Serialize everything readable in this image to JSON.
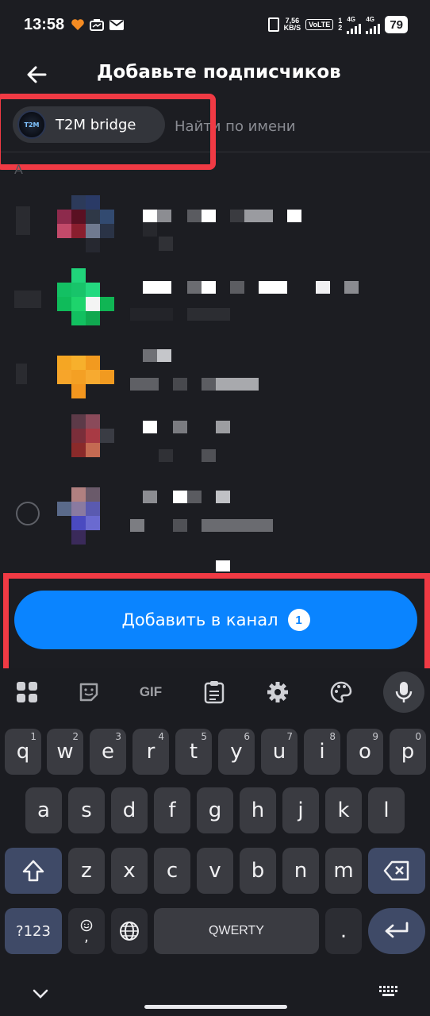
{
  "status_bar": {
    "time": "13:58",
    "speed_value": "7,56",
    "speed_unit": "KB/S",
    "volte": "VoLTE",
    "sim1": "1",
    "sim2": "2",
    "network1": "4G",
    "network2": "4G",
    "battery": "79"
  },
  "header": {
    "title": "Добавьте подписчиков",
    "back_icon": "arrow-left-icon"
  },
  "selection": {
    "chip_label": "T2M bridge",
    "chip_avatar_text": "T2M",
    "search_placeholder": "Найти по имени"
  },
  "list": {
    "section_letter": "A",
    "contacts": [
      {
        "selected": false,
        "name": "",
        "status": ""
      },
      {
        "selected": false,
        "name": "",
        "status": ""
      },
      {
        "selected": false,
        "name": "",
        "status": ""
      },
      {
        "selected": false,
        "name": "",
        "status": ""
      },
      {
        "selected": false,
        "name": "",
        "status": ""
      },
      {
        "selected": false,
        "name": "",
        "status": ""
      }
    ]
  },
  "action": {
    "add_label": "Добавить в канал",
    "count": "1"
  },
  "keyboard": {
    "toolbar": {
      "gif_label": "GIF"
    },
    "row1": [
      {
        "key": "q",
        "hint": "1"
      },
      {
        "key": "w",
        "hint": "2"
      },
      {
        "key": "e",
        "hint": "3"
      },
      {
        "key": "r",
        "hint": "4"
      },
      {
        "key": "t",
        "hint": "5"
      },
      {
        "key": "y",
        "hint": "6"
      },
      {
        "key": "u",
        "hint": "7"
      },
      {
        "key": "i",
        "hint": "8"
      },
      {
        "key": "o",
        "hint": "9"
      },
      {
        "key": "p",
        "hint": "0"
      }
    ],
    "row2": [
      "a",
      "s",
      "d",
      "f",
      "g",
      "h",
      "j",
      "k",
      "l"
    ],
    "row3": [
      "z",
      "x",
      "c",
      "v",
      "b",
      "n",
      "m"
    ],
    "symbols_label": "?123",
    "comma_label": ",",
    "space_label": "QWERTY",
    "period_label": "."
  },
  "colors": {
    "accent": "#0a84ff",
    "highlight_red": "#f03a44",
    "background": "#1c1d22"
  }
}
